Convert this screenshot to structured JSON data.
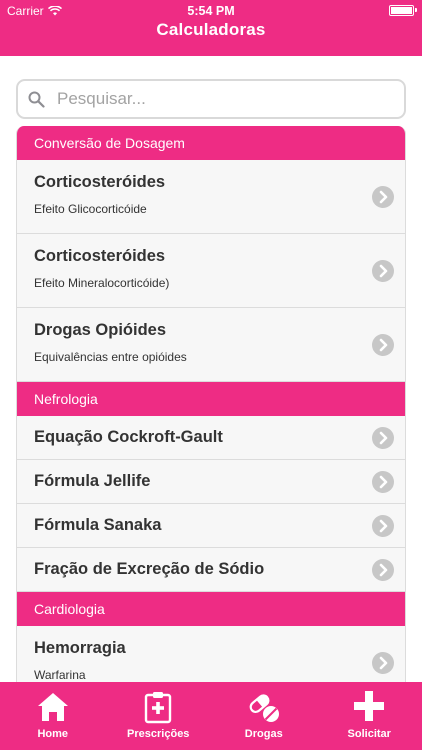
{
  "status_bar": {
    "carrier": "Carrier",
    "time": "5:54 PM"
  },
  "header": {
    "title": "Calculadoras"
  },
  "search": {
    "placeholder": "Pesquisar..."
  },
  "sections": [
    {
      "title": "Conversão de Dosagem",
      "items": [
        {
          "label": "Corticosteróides",
          "subtitle": "Efeito Glicocorticóide"
        },
        {
          "label": "Corticosteróides",
          "subtitle": "Efeito Mineralocorticóide)"
        },
        {
          "label": "Drogas Opióides",
          "subtitle": "Equivalências entre opióides"
        }
      ]
    },
    {
      "title": "Nefrologia",
      "items": [
        {
          "label": "Equação Cockroft-Gault"
        },
        {
          "label": "Fórmula Jellife"
        },
        {
          "label": "Fórmula Sanaka"
        },
        {
          "label": "Fração de Excreção de Sódio"
        }
      ]
    },
    {
      "title": "Cardiologia",
      "items": [
        {
          "label": "Hemorragia",
          "subtitle": "Warfarina"
        }
      ]
    }
  ],
  "tabbar": {
    "tabs": [
      {
        "label": "Home",
        "icon": "home-icon"
      },
      {
        "label": "Prescrições",
        "icon": "clipboard-icon"
      },
      {
        "label": "Drogas",
        "icon": "pills-icon"
      },
      {
        "label": "Solicitar",
        "icon": "plus-icon"
      }
    ]
  },
  "colors": {
    "accent": "#ee2c84",
    "row_bg": "#f7f7f7",
    "chevron": "#c7c7c7",
    "text": "#333333"
  }
}
